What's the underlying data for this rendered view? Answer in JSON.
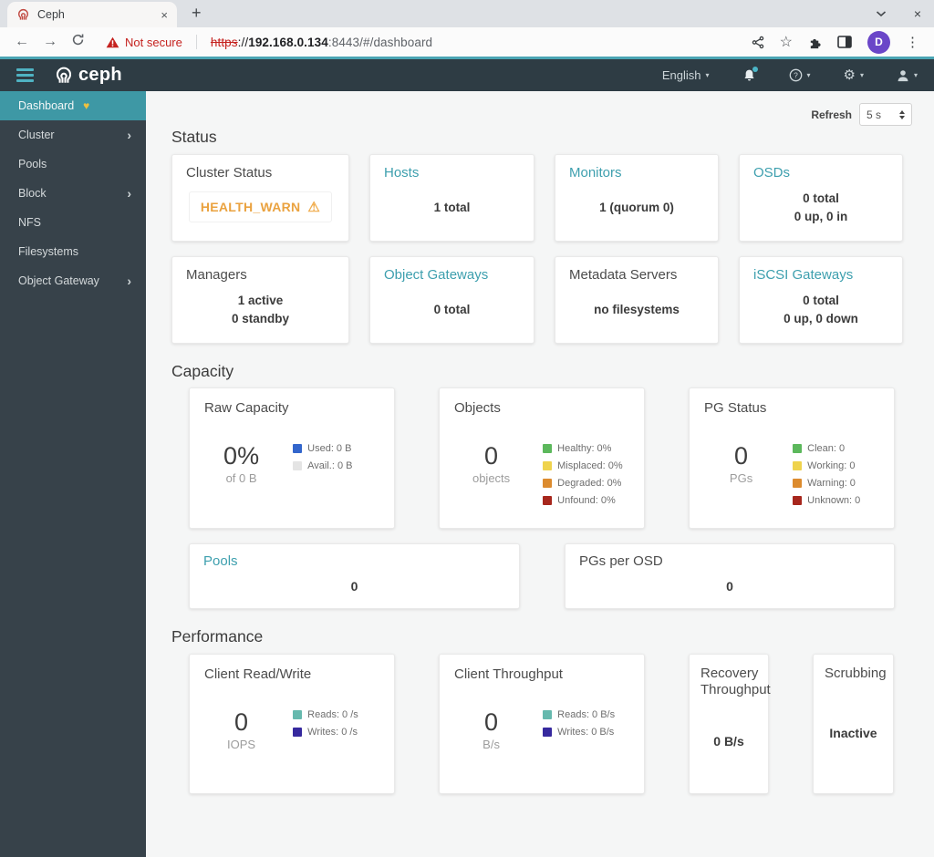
{
  "browser": {
    "tab": {
      "title": "Ceph"
    },
    "address": {
      "warning": "Not secure",
      "scheme": "https",
      "separator": "://",
      "host": "192.168.0.134",
      "path": ":8443/#/dashboard"
    },
    "profile_initial": "D"
  },
  "icons": {
    "close": "×",
    "plus": "+",
    "back": "←",
    "forward": "→",
    "star": "☆",
    "menu_dots": "⋮",
    "caret_down": "▾",
    "chevron_right": "›",
    "gear": "⚙",
    "heart": "♥",
    "warning": "⚠"
  },
  "navbar": {
    "brand": "ceph",
    "language": "English"
  },
  "sidebar": {
    "items": [
      {
        "label": "Dashboard"
      },
      {
        "label": "Cluster"
      },
      {
        "label": "Pools"
      },
      {
        "label": "Block"
      },
      {
        "label": "NFS"
      },
      {
        "label": "Filesystems"
      },
      {
        "label": "Object Gateway"
      }
    ]
  },
  "toolbar": {
    "refresh_label": "Refresh",
    "interval": "5 s"
  },
  "status": {
    "heading": "Status",
    "cluster_status": {
      "title": "Cluster Status",
      "health": "HEALTH_WARN"
    },
    "hosts": {
      "title": "Hosts",
      "line1": "1 total"
    },
    "monitors": {
      "title": "Monitors",
      "line1": "1 (quorum 0)"
    },
    "osds": {
      "title": "OSDs",
      "line1": "0 total",
      "line2": "0 up, 0 in"
    },
    "managers": {
      "title": "Managers",
      "line1": "1 active",
      "line2": "0 standby"
    },
    "object_gateways": {
      "title": "Object Gateways",
      "line1": "0 total"
    },
    "metadata_servers": {
      "title": "Metadata Servers",
      "line1": "no filesystems"
    },
    "iscsi_gateways": {
      "title": "iSCSI Gateways",
      "line1": "0 total",
      "line2": "0 up, 0 down"
    }
  },
  "capacity": {
    "heading": "Capacity",
    "raw_capacity": {
      "title": "Raw Capacity",
      "value": "0%",
      "sub": "of 0 B",
      "legend": [
        {
          "label": "Used: 0 B",
          "color": "#3366cc"
        },
        {
          "label": "Avail.: 0 B",
          "color": "#e4e4e4"
        }
      ]
    },
    "objects": {
      "title": "Objects",
      "value": "0",
      "sub": "objects",
      "legend": [
        {
          "label": "Healthy: 0%",
          "color": "#5cb85c"
        },
        {
          "label": "Misplaced: 0%",
          "color": "#efd34d"
        },
        {
          "label": "Degraded: 0%",
          "color": "#dc8b2e"
        },
        {
          "label": "Unfound: 0%",
          "color": "#a7271d"
        }
      ]
    },
    "pg_status": {
      "title": "PG Status",
      "value": "0",
      "sub": "PGs",
      "legend": [
        {
          "label": "Clean: 0",
          "color": "#5cb85c"
        },
        {
          "label": "Working: 0",
          "color": "#efd34d"
        },
        {
          "label": "Warning: 0",
          "color": "#dc8b2e"
        },
        {
          "label": "Unknown: 0",
          "color": "#a7271d"
        }
      ]
    },
    "pools": {
      "title": "Pools",
      "value": "0"
    },
    "pgs_per_osd": {
      "title": "PGs per OSD",
      "value": "0"
    }
  },
  "performance": {
    "heading": "Performance",
    "client_read_write": {
      "title": "Client Read/Write",
      "value": "0",
      "sub": "IOPS",
      "legend": [
        {
          "label": "Reads: 0 /s",
          "color": "#66b9ae"
        },
        {
          "label": "Writes: 0 /s",
          "color": "#36299e"
        }
      ]
    },
    "client_throughput": {
      "title": "Client Throughput",
      "value": "0",
      "sub": "B/s",
      "legend": [
        {
          "label": "Reads: 0 B/s",
          "color": "#66b9ae"
        },
        {
          "label": "Writes: 0 B/s",
          "color": "#36299e"
        }
      ]
    },
    "recovery_throughput": {
      "title": "Recovery Throughput",
      "value": "0 B/s"
    },
    "scrubbing": {
      "title": "Scrubbing",
      "value": "Inactive"
    }
  },
  "theme": {
    "accent_teal": "#3e98a5",
    "link_teal": "#3d9fae",
    "health_warn_orange": "#eaa23f",
    "navbar_bg": "#2e3c44",
    "sidebar_bg": "#37424a",
    "navbar_accent_line": "#4aa5b4",
    "url_warning_red": "#c5221f",
    "avatar_purple": "#6a46c8"
  }
}
